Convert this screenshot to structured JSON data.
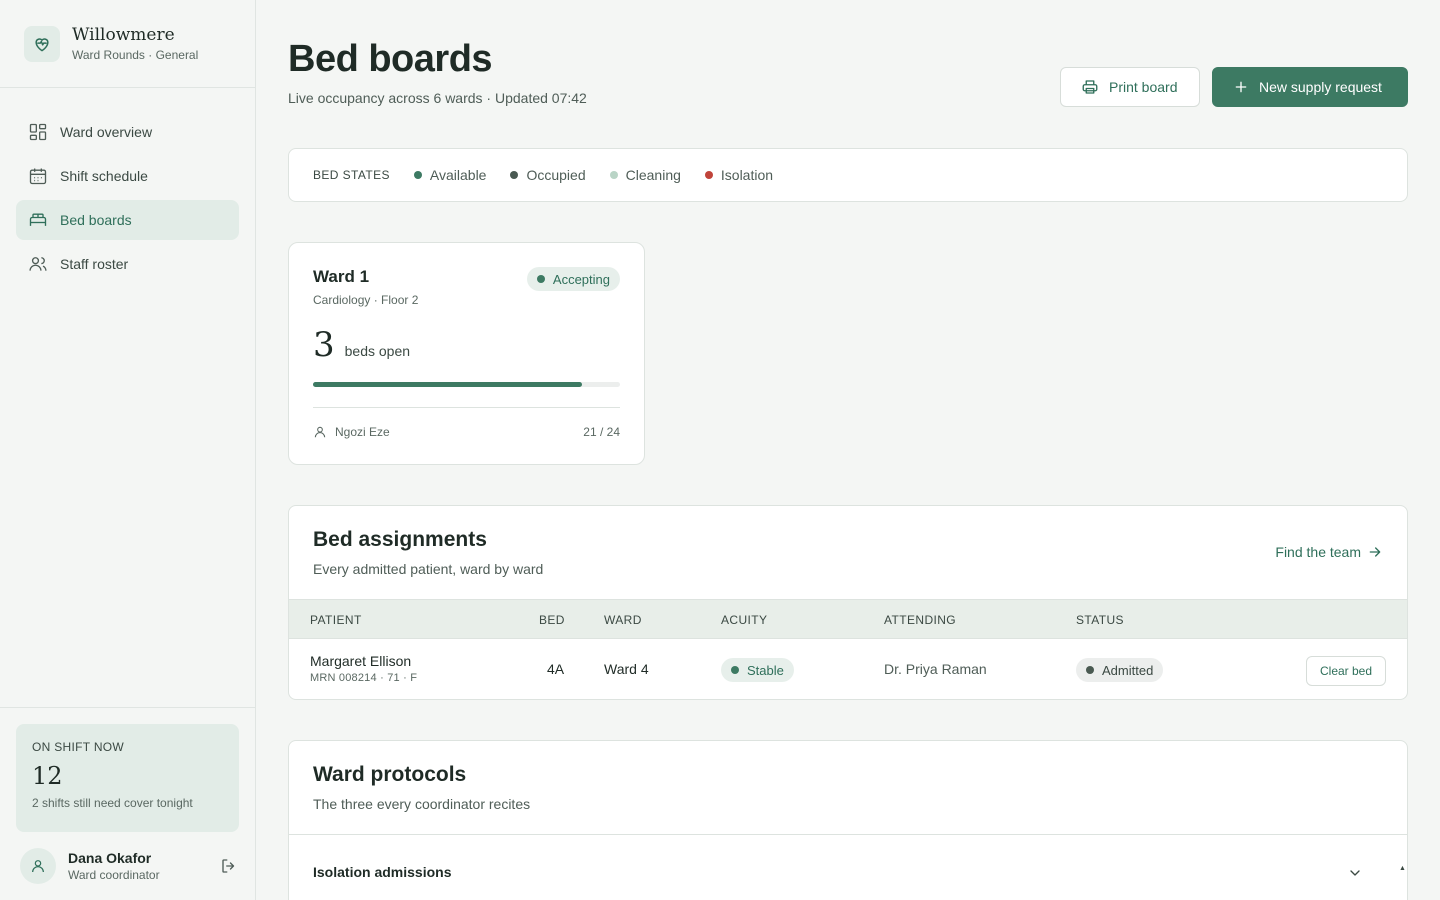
{
  "brand": {
    "name": "Willowmere",
    "subtitle": "Ward Rounds · General"
  },
  "nav": [
    {
      "label": "Ward overview",
      "icon": "grid-icon",
      "active": false
    },
    {
      "label": "Shift schedule",
      "icon": "calendar-icon",
      "active": false
    },
    {
      "label": "Bed boards",
      "icon": "bed-icon",
      "active": true
    },
    {
      "label": "Staff roster",
      "icon": "users-icon",
      "active": false
    }
  ],
  "shift": {
    "label": "ON SHIFT NOW",
    "count": "12",
    "note": "2 shifts still need cover tonight"
  },
  "user": {
    "name": "Dana Okafor",
    "role": "Ward coordinator"
  },
  "header": {
    "title": "Bed boards",
    "subtitle": "Live occupancy across 6 wards · Updated 07:42",
    "print_label": "Print board",
    "new_request_label": "New supply request"
  },
  "legend": {
    "title": "BED STATES",
    "items": [
      {
        "label": "Available",
        "color": "#3d7a63"
      },
      {
        "label": "Occupied",
        "color": "#4a5a52"
      },
      {
        "label": "Cleaning",
        "color": "#b9d4c6"
      },
      {
        "label": "Isolation",
        "color": "#c0443a"
      }
    ]
  },
  "ward_card": {
    "name": "Ward 1",
    "subtitle": "Cardiology · Floor 2",
    "badge": "Accepting",
    "beds_open": "3",
    "beds_label": "beds open",
    "occupancy_fraction": 0.875,
    "nurse": "Ngozi Eze",
    "count": "21 / 24"
  },
  "assignments": {
    "title": "Bed assignments",
    "subtitle": "Every admitted patient, ward by ward",
    "link_label": "Find the team",
    "columns": [
      "PATIENT",
      "BED",
      "WARD",
      "ACUITY",
      "ATTENDING",
      "STATUS"
    ],
    "rows": [
      {
        "patient": "Margaret Ellison",
        "mrn": "MRN 008214 · 71 · F",
        "bed": "4A",
        "ward": "Ward 4",
        "acuity": "Stable",
        "attending": "Dr. Priya Raman",
        "status": "Admitted",
        "action": "Clear bed"
      }
    ]
  },
  "protocols": {
    "title": "Ward protocols",
    "subtitle": "The three every coordinator recites",
    "items": [
      {
        "label": "Isolation admissions"
      }
    ]
  },
  "colors": {
    "accent": "#3d7a63",
    "background": "#f4f6f4"
  }
}
